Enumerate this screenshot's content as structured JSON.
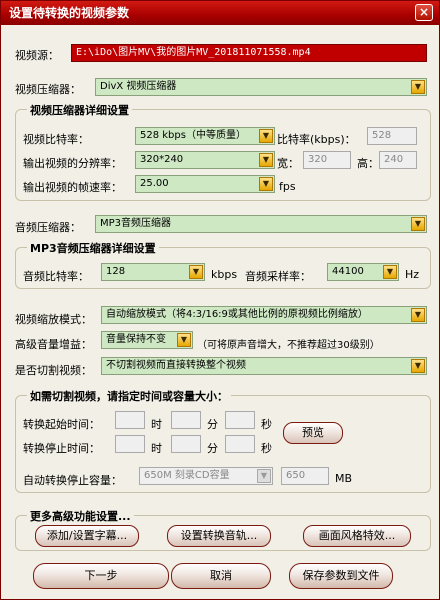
{
  "window": {
    "title": "设置待转换的视频参数",
    "close_label": "×"
  },
  "video_source": {
    "label": "视频源：",
    "value": "E:\\iDo\\图片MV\\我的图片MV_201811071558.mp4"
  },
  "video_codec": {
    "label": "视频压缩器：",
    "value": "DivX 视频压缩器"
  },
  "video_detail": {
    "title": "视频压缩器详细设置",
    "bitrate_label": "视频比特率：",
    "bitrate_value": "528  kbps（中等质量）",
    "bitrate_kbps_label": "比特率(kbps)：",
    "bitrate_kbps_value": "528",
    "resolution_label": "输出视频的分辨率：",
    "resolution_value": "320*240",
    "width_label": "宽：",
    "width_value": "320",
    "height_label": "高：",
    "height_value": "240",
    "framerate_label": "输出视频的帧速率：",
    "framerate_value": "25.00",
    "fps_label": "fps"
  },
  "audio_codec": {
    "label": "音频压缩器：",
    "value": "MP3音频压缩器"
  },
  "audio_detail": {
    "title": "MP3音频压缩器详细设置",
    "bitrate_label": "音频比特率：",
    "bitrate_value": "128",
    "kbps_label": "kbps",
    "samplerate_label": "音频采样率：",
    "samplerate_value": "44100",
    "hz_label": "Hz"
  },
  "scale_mode": {
    "label": "视频缩放模式：",
    "value": "自动缩放模式（将4:3/16:9或其他比例的原视频比例缩放）"
  },
  "volume_gain": {
    "label": "高级音量增益：",
    "value": "音量保持不变",
    "note": "（可将原声音增大，不推荐超过30级别）"
  },
  "cut_video": {
    "label": "是否切割视频：",
    "value": "不切割视频而直接转换整个视频"
  },
  "cut_group": {
    "title": "如需切割视频，请指定时间或容量大小：",
    "start_label": "转换起始时间：",
    "stop_label": "转换停止时间：",
    "hour_label": "时",
    "minute_label": "分",
    "second_label": "秒",
    "preview_label": "预览",
    "auto_stop_label": "自动转换停止容量：",
    "capacity_value": "650M 刻录CD容量",
    "capacity_mb_value": "650",
    "mb_label": "MB"
  },
  "advanced": {
    "title": "更多高级功能设置...",
    "subtitle_button": "添加/设置字幕...",
    "audio_track_button": "设置转换音轨...",
    "effects_button": "画面风格特效..."
  },
  "footer": {
    "next_button": "下一步",
    "cancel_button": "取消",
    "save_button": "保存参数到文件"
  }
}
